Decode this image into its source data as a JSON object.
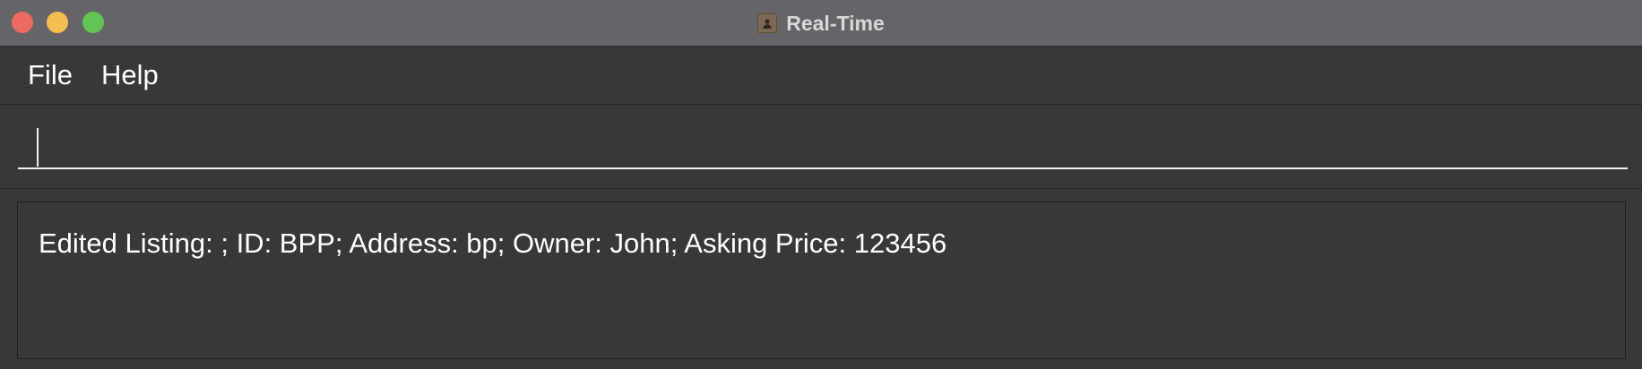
{
  "window": {
    "title": "Real-Time",
    "app_icon": "contact-card-icon",
    "controls": {
      "close_color": "#ec6a5f",
      "minimize_color": "#f4bf50",
      "zoom_color": "#61c554"
    }
  },
  "menu": {
    "items": [
      {
        "label": "File"
      },
      {
        "label": "Help"
      }
    ]
  },
  "command_box": {
    "value": "",
    "placeholder": ""
  },
  "result_display": {
    "text": "Edited Listing: ; ID: BPP; Address: bp; Owner: John; Asking Price: 123456"
  },
  "colors": {
    "titlebar": "#656469",
    "background": "#383838",
    "text": "#ffffff"
  }
}
